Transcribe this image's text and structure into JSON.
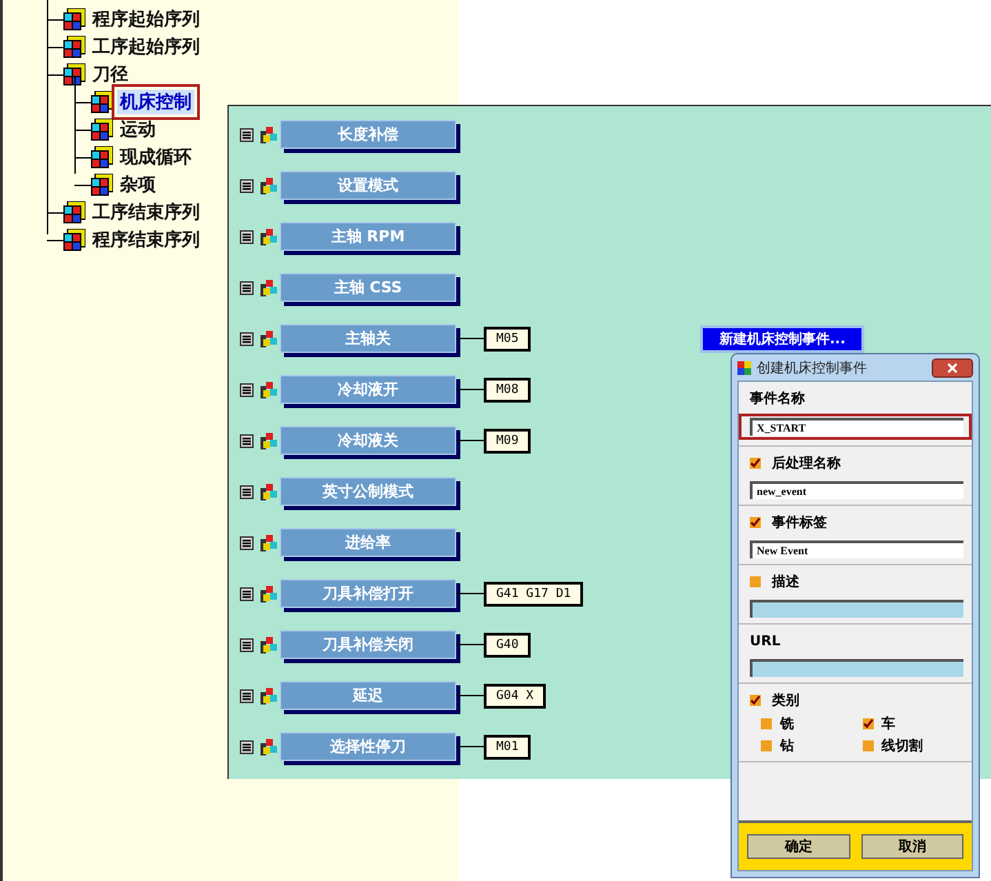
{
  "tree": [
    {
      "label": "程序起始序列",
      "selected": false
    },
    {
      "label": "工序起始序列",
      "selected": false
    },
    {
      "label": "刀径",
      "selected": false,
      "children": [
        {
          "label": "机床控制",
          "selected": true
        },
        {
          "label": "运动",
          "selected": false
        },
        {
          "label": "现成循环",
          "selected": false
        },
        {
          "label": "杂项",
          "selected": false
        }
      ]
    },
    {
      "label": "工序结束序列",
      "selected": false
    },
    {
      "label": "程序结束序列",
      "selected": false
    }
  ],
  "canvas": {
    "rows": [
      {
        "label": "长度补偿"
      },
      {
        "label": "设置模式"
      },
      {
        "label": "主轴 RPM"
      },
      {
        "label": "主轴 CSS"
      },
      {
        "label": "主轴关",
        "code": "M05"
      },
      {
        "label": "冷却液开",
        "code": "M08"
      },
      {
        "label": "冷却液关",
        "code": "M09"
      },
      {
        "label": "英寸公制模式"
      },
      {
        "label": "进给率"
      },
      {
        "label": "刀具补偿打开",
        "code": "G41 G17 D1"
      },
      {
        "label": "刀具补偿关闭",
        "code": "G40"
      },
      {
        "label": "延迟",
        "code": "G04 X"
      },
      {
        "label": "选择性停刀",
        "code": "M01"
      }
    ]
  },
  "new_event_label": "新建机床控制事件...",
  "dialog": {
    "title": "创建机床控制事件",
    "sections": [
      {
        "kind": "field",
        "label": "事件名称",
        "value": "X_START",
        "disabled": false,
        "highlighted": true
      },
      {
        "kind": "check_field",
        "label": "后处理名称",
        "checked": true,
        "value": "new_event",
        "disabled": false,
        "highlighted": false
      },
      {
        "kind": "check_field",
        "label": "事件标签",
        "checked": true,
        "value": "New Event",
        "disabled": false,
        "highlighted": false
      },
      {
        "kind": "check_field",
        "label": "描述",
        "checked": false,
        "disabled": true,
        "highlighted": false
      },
      {
        "kind": "field",
        "label": "URL",
        "disabled": true,
        "highlighted": false
      },
      {
        "kind": "category",
        "label": "类别",
        "checked": true,
        "options": [
          {
            "label": "铣",
            "checked": false
          },
          {
            "label": "车",
            "checked": true
          },
          {
            "label": "钻",
            "checked": false
          },
          {
            "label": "线切割",
            "checked": false
          }
        ]
      }
    ],
    "buttons": [
      "确定",
      "取消"
    ]
  }
}
